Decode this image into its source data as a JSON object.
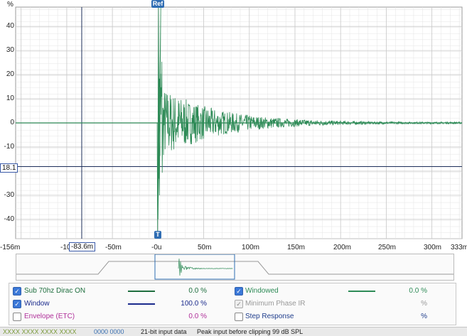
{
  "app": {
    "y_unit": "%"
  },
  "markers": {
    "ref": "Ref",
    "t": "T"
  },
  "cursor": {
    "y_readout": "18.1",
    "x_readout": "-83.6m"
  },
  "axis": {
    "y_ticks": [
      "40",
      "30",
      "20",
      "10",
      "0",
      "-10",
      "-20",
      "-30",
      "-40"
    ],
    "x_ticks": [
      "-156m",
      "-10",
      "-50m",
      "-0u",
      "50m",
      "100m",
      "150m",
      "200m",
      "250m",
      "300m",
      "333m"
    ]
  },
  "legend": {
    "items": [
      {
        "label": "Sub 70hz Dirac ON",
        "checked": true,
        "value": "0.0 %",
        "color": "#1e6e3e"
      },
      {
        "label": "Window",
        "checked": true,
        "value": "100.0 %",
        "color": "#1a2a8c"
      },
      {
        "label": "Envelope (ETC)",
        "checked": false,
        "value": "0.0 %",
        "color": "#b0309a"
      },
      {
        "label": "Windowed",
        "checked": true,
        "value": "0.0 %",
        "color": "#2e8b57"
      },
      {
        "label": "Minimum Phase IR",
        "checked": true,
        "disabled": true,
        "value": "%",
        "color": "#999999"
      },
      {
        "label": "Step Response",
        "checked": false,
        "value": "%",
        "color": "#1f3d8c"
      }
    ]
  },
  "status": {
    "left": "XXXX XXXX XXXX XXXX",
    "meter": "0000 0000",
    "input_format": "21-bit input data",
    "peak": "Peak input before clipping 99 dB SPL"
  },
  "colors": {
    "trace": "#2e8b57",
    "grid_major": "#c9c9c9",
    "grid_minor": "#e4e4e4",
    "cursor": "#1d2f5a",
    "window": "#1a2a8c"
  },
  "chart_data": {
    "type": "line",
    "xlabel": "",
    "ylabel": "%",
    "x_range_ms": [
      -156,
      333
    ],
    "ylim": [
      -48,
      48
    ],
    "peak_time_ms": 0,
    "envelope_peak_pct": [
      48,
      -48
    ],
    "decay_description_points": [
      [
        0,
        -48
      ],
      [
        2,
        48
      ],
      [
        5,
        15
      ],
      [
        20,
        10
      ],
      [
        50,
        6
      ],
      [
        100,
        3
      ],
      [
        150,
        1.5
      ],
      [
        200,
        1
      ],
      [
        333,
        0.5
      ]
    ]
  }
}
